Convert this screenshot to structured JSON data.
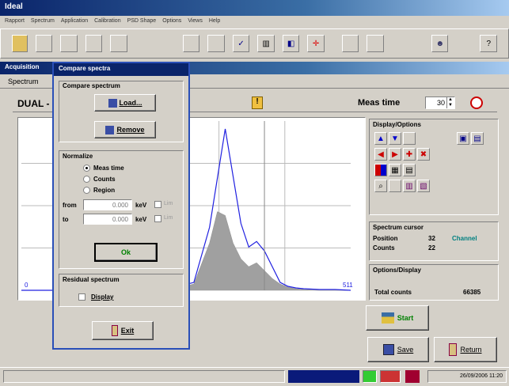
{
  "app": {
    "title": "Ideal",
    "window_title": "Acquisition"
  },
  "menu": [
    "Rapport",
    "Spectrum",
    "Application",
    "Calibration",
    "PSD Shape",
    "Options",
    "Views",
    "Help"
  ],
  "window_tab": "Spectrum",
  "spectrum_label": "DUAL -",
  "meas_time": {
    "label": "Meas time",
    "value": "30"
  },
  "chart_data": {
    "type": "line",
    "series": [
      {
        "color": "#2020e0",
        "x": [
          0,
          20,
          40,
          60,
          80,
          100,
          120,
          140,
          160,
          180,
          200,
          220,
          240,
          260,
          280,
          290,
          300,
          310,
          320,
          330,
          340,
          350,
          360,
          380,
          400,
          420
        ],
        "y": [
          0,
          0,
          0,
          0,
          1,
          1,
          1,
          1,
          2,
          3,
          5,
          10,
          80,
          205,
          85,
          55,
          62,
          50,
          30,
          10,
          5,
          3,
          2,
          1,
          1,
          0
        ]
      },
      {
        "fill": "#a0a0a0",
        "x": [
          0,
          100,
          200,
          220,
          240,
          250,
          260,
          270,
          280,
          290,
          300,
          310,
          320,
          330,
          340,
          350,
          360,
          380,
          420
        ],
        "y": [
          0,
          0,
          3,
          8,
          60,
          100,
          95,
          60,
          40,
          30,
          35,
          25,
          15,
          8,
          4,
          2,
          1,
          0,
          0
        ]
      }
    ],
    "grid": true,
    "cursor_x": "32",
    "x_tick_start": "0",
    "x_tick_end": "511",
    "ylim": [
      0,
      215
    ]
  },
  "display_options": {
    "title": "Display/Options"
  },
  "spectrum_cursor": {
    "title": "Spectrum cursor",
    "position_label": "Position",
    "position_value": "32",
    "position_unit": "Channel",
    "counts_label": "Counts",
    "counts_value": "22"
  },
  "options_display": {
    "title": "Options/Display",
    "total_counts_label": "Total counts",
    "total_counts_value": "66385"
  },
  "actions": {
    "start": "Start",
    "save": "Save",
    "return": "Return"
  },
  "status_datetime": "26/09/2006 11:20",
  "dialog": {
    "title": "Compare spectra",
    "compare_group": "Compare spectrum",
    "load": "Load...",
    "remove": "Remove",
    "normalize_group": "Normalize",
    "options": [
      "Meas time",
      "Counts",
      "Region"
    ],
    "selected": 0,
    "from_label": "from",
    "from_value": "0.000",
    "from_unit": "keV",
    "to_label": "to",
    "to_value": "0.000",
    "to_unit": "keV",
    "lim_label": "Lim",
    "ok": "Ok",
    "residual_group": "Residual spectrum",
    "display": "Display",
    "exit": "Exit"
  }
}
